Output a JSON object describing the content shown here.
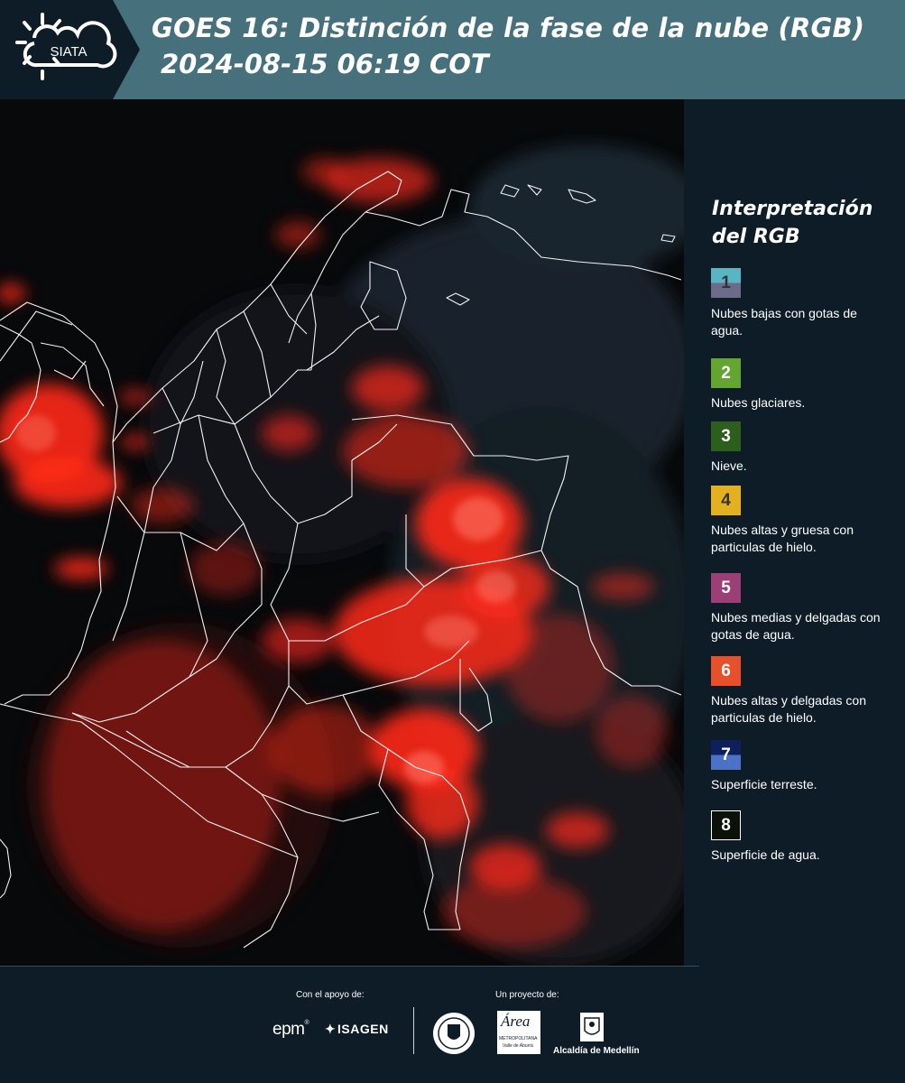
{
  "header": {
    "logo_text": "SIATA",
    "title_line1": "GOES 16: Distinción de la fase de la nube (RGB)",
    "title_line2": "2024-08-15 06:19 COT"
  },
  "legend": {
    "title_line1": "Interpretación",
    "title_line2": "del RGB",
    "items": [
      {
        "number": "1",
        "label": "Nubes bajas con gotas de agua.",
        "color_top": "#59b5c3",
        "color_bottom": "#6d6b8a",
        "text_color": "#333333"
      },
      {
        "number": "2",
        "label": "Nubes glaciares.",
        "color_top": "#64a531",
        "color_bottom": "#64a531",
        "text_color": "#ffffff"
      },
      {
        "number": "3",
        "label": "Nieve.",
        "color_top": "#2d5e1d",
        "color_bottom": "#2d5e1d",
        "text_color": "#ffffff"
      },
      {
        "number": "4",
        "label": "Nubes altas y gruesa con particulas de hielo.",
        "color_top": "#e3b120",
        "color_bottom": "#e3b120",
        "text_color": "#333333"
      },
      {
        "number": "5",
        "label": "Nubes medias y delgadas con gotas de agua.",
        "color_top": "#9c3f77",
        "color_bottom": "#9c3f77",
        "text_color": "#ffffff"
      },
      {
        "number": "6",
        "label": "Nubes altas y delgadas con particulas de hielo.",
        "color_top": "#e8502b",
        "color_bottom": "#e8502b",
        "text_color": "#ffffff"
      },
      {
        "number": "7",
        "label": "Superficie terreste.",
        "color_top": "#0e1f5c",
        "color_bottom": "#4a73c8",
        "text_color": "#ffffff"
      },
      {
        "number": "8",
        "label": "Superficie de agua.",
        "color_top": "#0a1108",
        "color_bottom": "#0a1108",
        "text_color": "#ffffff"
      }
    ]
  },
  "footer": {
    "support_caption": "Con el apoyo de:",
    "project_caption": "Un proyecto de:",
    "epm_text": "epm",
    "isagen_text": "ISAGEN",
    "area_text": "Área",
    "area_subtext1": "METROPOLITANA",
    "area_subtext2": "Valle de Aburrá",
    "alcaldia_text": "Alcaldía de Medellín"
  },
  "colors": {
    "header_bg": "#47707d",
    "panel_bg": "#0d1c26",
    "cloud_red": "#ff2a1a",
    "boundary": "#ffffff"
  }
}
